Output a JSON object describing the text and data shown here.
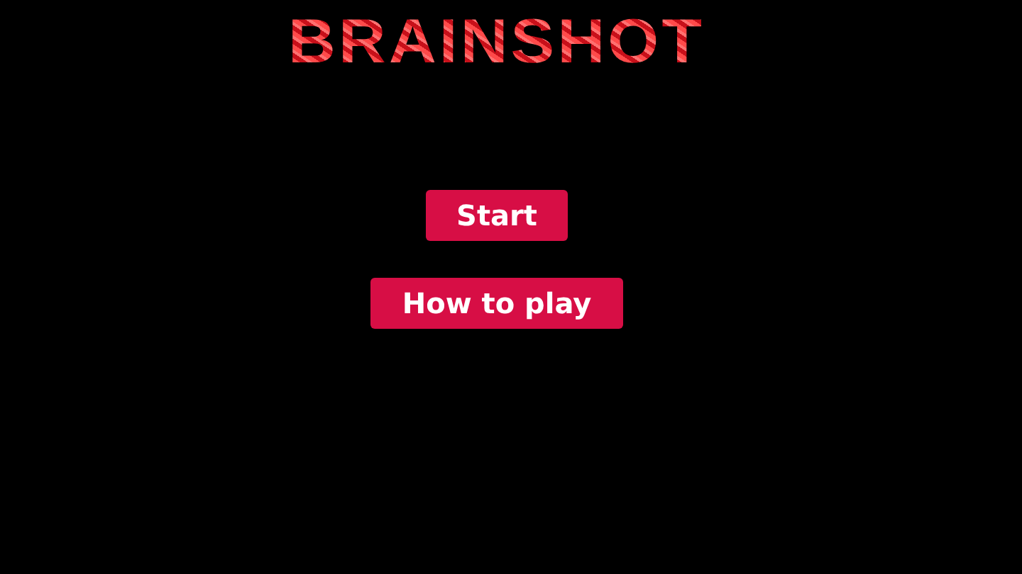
{
  "logo": "BRAINSHOT",
  "menu": [
    {
      "label": "Start"
    },
    {
      "label": "How to play"
    }
  ]
}
